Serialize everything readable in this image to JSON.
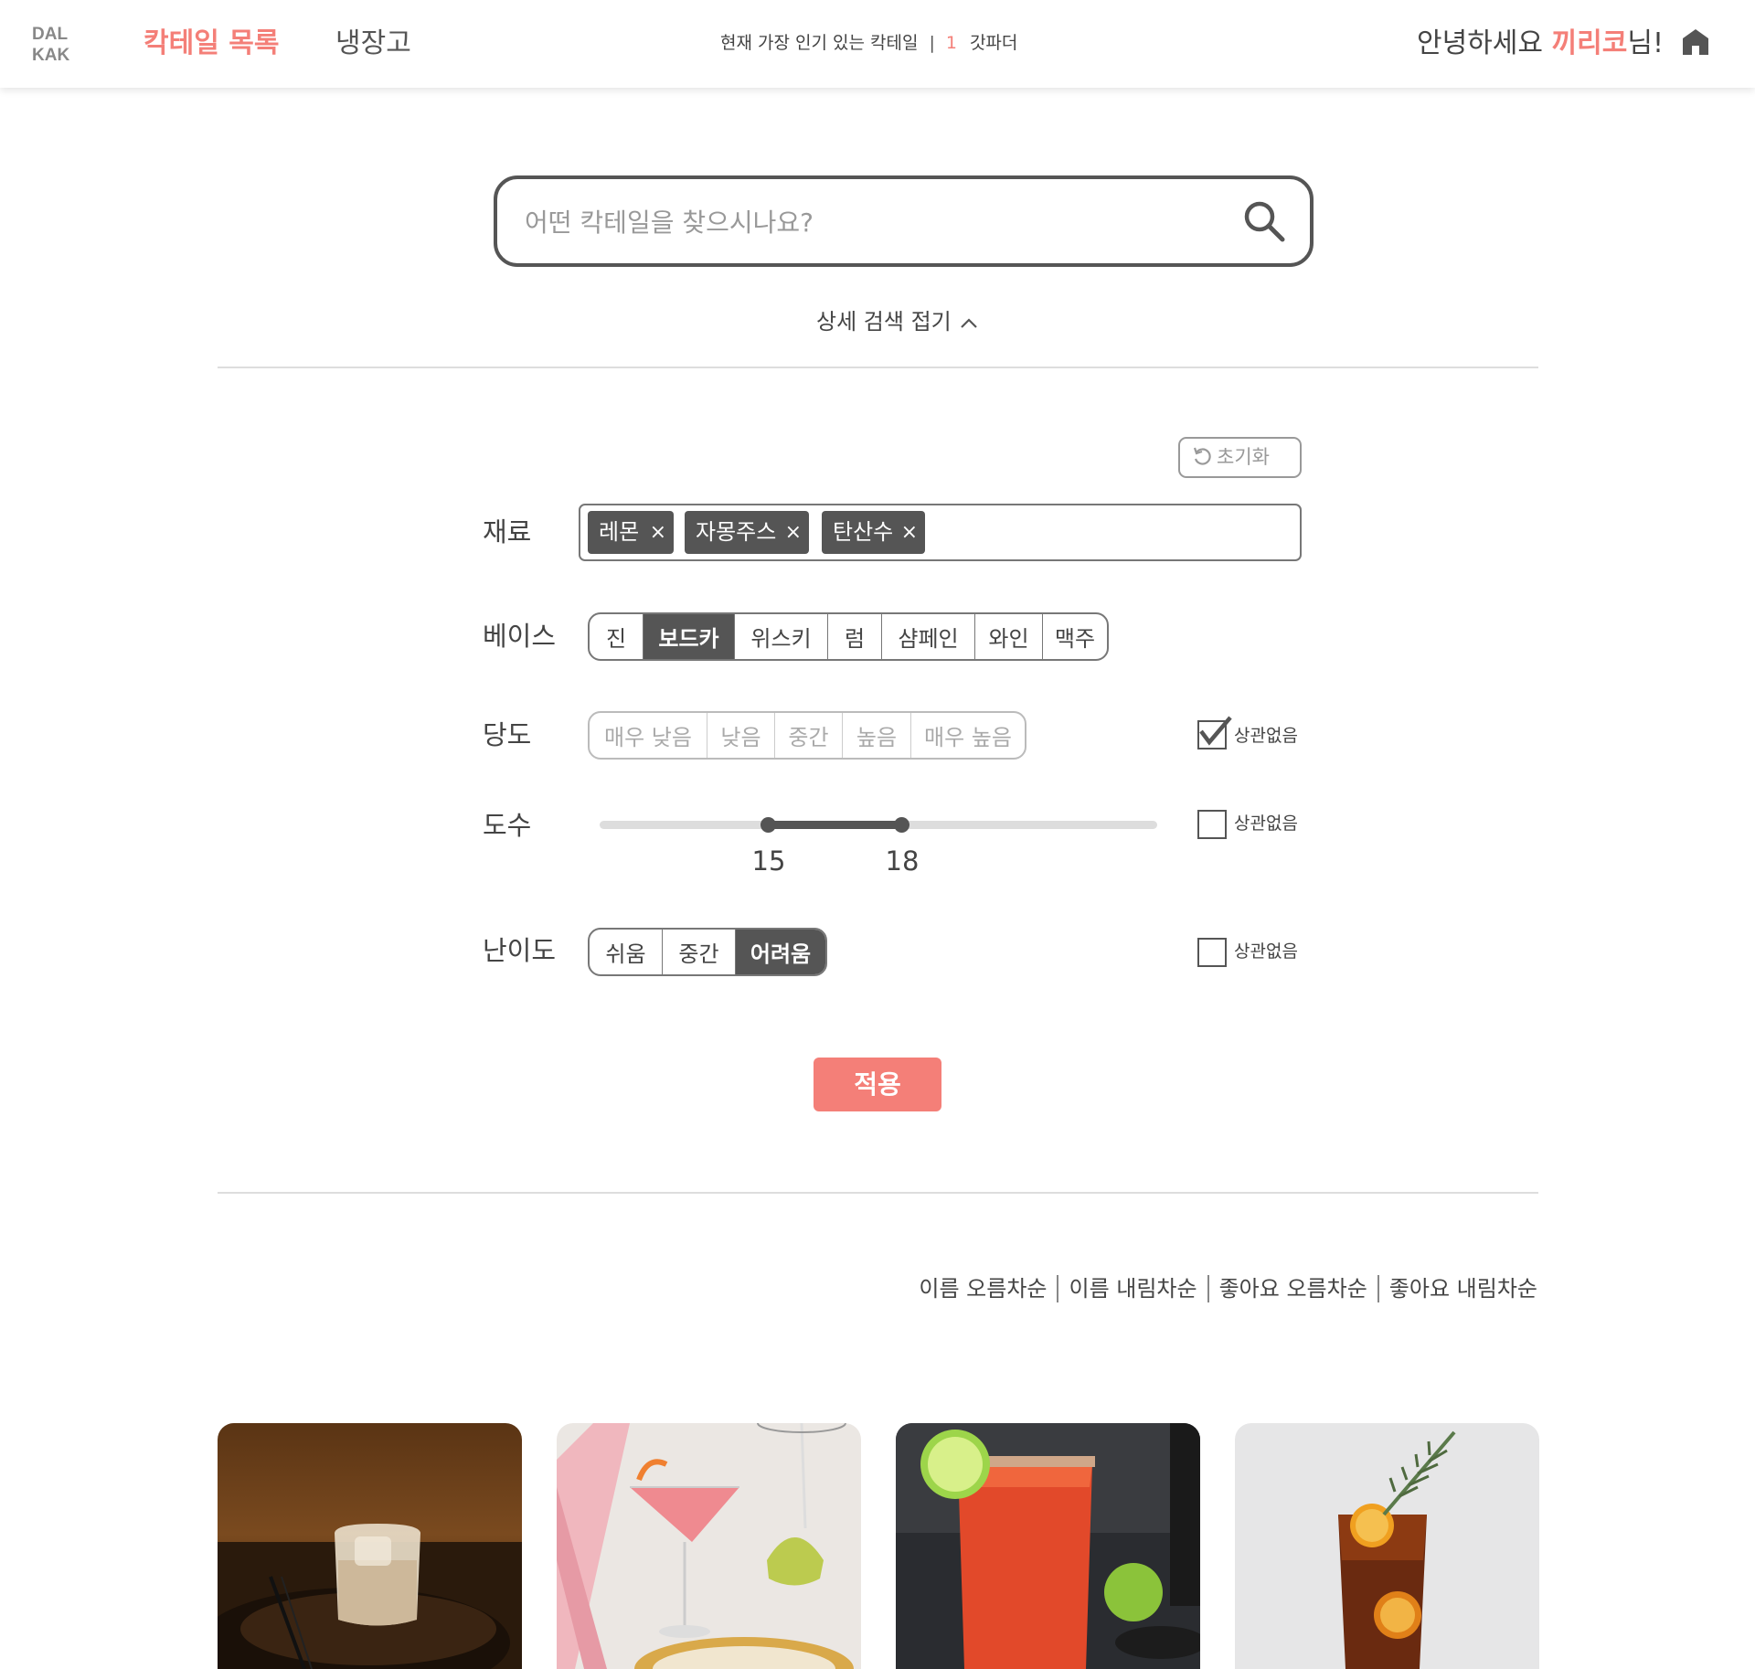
{
  "header": {
    "logo_line1": "DAL",
    "logo_line2": "KAK",
    "nav": {
      "cocktails": "칵테일 목록",
      "fridge": "냉장고"
    },
    "popular": {
      "label": "현재 가장 인기 있는 칵테일",
      "separator": "|",
      "rank": "1",
      "name": "갓파더"
    },
    "greeting": {
      "prefix": "안녕하세요 ",
      "username": "끼리코",
      "suffix": "님!"
    },
    "home_icon": "home-icon"
  },
  "search": {
    "placeholder": "어떤 칵테일을 찾으시나요?",
    "value": "",
    "icon": "search-icon"
  },
  "advanced_toggle": {
    "label": "상세 검색 접기",
    "icon": "chevron-up-icon"
  },
  "filters": {
    "reset_label": "초기화",
    "reset_icon": "reset-icon",
    "ingredients": {
      "label": "재료",
      "tags": [
        "레몬",
        "자몽주스",
        "탄산수"
      ],
      "remove_symbol": "×"
    },
    "base": {
      "label": "베이스",
      "options": [
        "진",
        "보드카",
        "위스키",
        "럼",
        "샴페인",
        "와인",
        "맥주"
      ],
      "selected": "보드카"
    },
    "sweetness": {
      "label": "당도",
      "options": [
        "매우 낮음",
        "낮음",
        "중간",
        "높음",
        "매우 높음"
      ],
      "any_label": "상관없음",
      "any_checked": true
    },
    "abv": {
      "label": "도수",
      "min": 15,
      "max": 18,
      "any_label": "상관없음",
      "any_checked": false
    },
    "difficulty": {
      "label": "난이도",
      "options": [
        "쉬움",
        "중간",
        "어려움"
      ],
      "selected": "어려움",
      "any_label": "상관없음",
      "any_checked": false
    },
    "apply_label": "적용"
  },
  "sort": {
    "options": [
      "이름 오름차순",
      "이름 내림차순",
      "좋아요 오름차순",
      "좋아요 내림차순"
    ]
  },
  "colors": {
    "accent": "#f47f78",
    "dark": "#555555",
    "border": "#777777"
  }
}
